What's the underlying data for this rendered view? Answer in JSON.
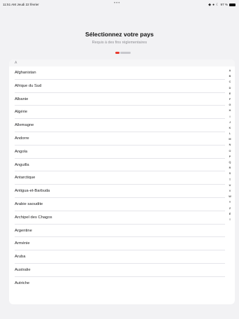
{
  "status_bar": {
    "time_date": "11:51 AM  Jeudi 22 février",
    "dots": "•••",
    "battery": "97 %"
  },
  "header": {
    "title": "Sélectionnez votre pays",
    "subtitle": "Requis à des fins réglementaires"
  },
  "progress": {
    "current_step": 1,
    "total_steps": 3,
    "active_color": "#e8392d"
  },
  "list": {
    "section_header": "A",
    "countries": [
      "Afghanistan",
      "Afrique du Sud",
      "Albanie",
      "Algérie",
      "Allemagne",
      "Andorre",
      "Angola",
      "Anguilla",
      "Antarctique",
      "Antigua-et-Barbuda",
      "Arabie saoudite",
      "Archipel des Chagos",
      "Argentine",
      "Arménie",
      "Aruba",
      "Australie",
      "Autriche"
    ]
  },
  "index_letters": [
    "A",
    "B",
    "C",
    "D",
    "E",
    "F",
    "G",
    "H",
    "I",
    "J",
    "K",
    "L",
    "M",
    "N",
    "O",
    "P",
    "Q",
    "R",
    "S",
    "T",
    "U",
    "V",
    "W",
    "Y",
    "Z",
    "É",
    "İ"
  ]
}
